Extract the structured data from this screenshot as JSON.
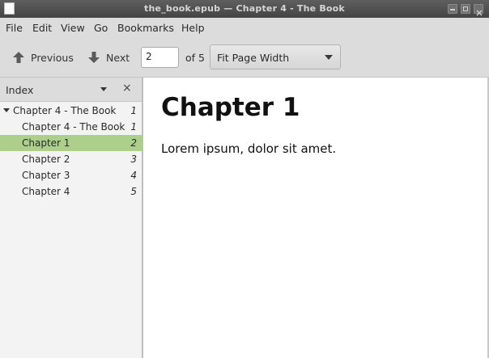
{
  "window": {
    "title": "the_book.epub — Chapter 4 - The Book"
  },
  "menubar": {
    "items": [
      "File",
      "Edit",
      "View",
      "Go",
      "Bookmarks",
      "Help"
    ]
  },
  "toolbar": {
    "previous_label": "Previous",
    "next_label": "Next",
    "page_value": "2",
    "of_label": "of 5",
    "zoom_value": "Fit Page Width"
  },
  "sidebar": {
    "title": "Index",
    "close_glyph": "×",
    "items": [
      {
        "label": "Chapter 4 - The Book",
        "page": "1"
      },
      {
        "label": "Chapter 4 - The Book",
        "page": "1"
      },
      {
        "label": "Chapter 1",
        "page": "2"
      },
      {
        "label": "Chapter 2",
        "page": "3"
      },
      {
        "label": "Chapter 3",
        "page": "4"
      },
      {
        "label": "Chapter 4",
        "page": "5"
      }
    ],
    "selected_index": 2,
    "selection_color": "#acd08b"
  },
  "document": {
    "heading": "Chapter 1",
    "body": "Lorem ipsum, dolor sit amet."
  },
  "icons": {
    "previous": "arrow-up-icon",
    "next": "arrow-down-icon"
  }
}
